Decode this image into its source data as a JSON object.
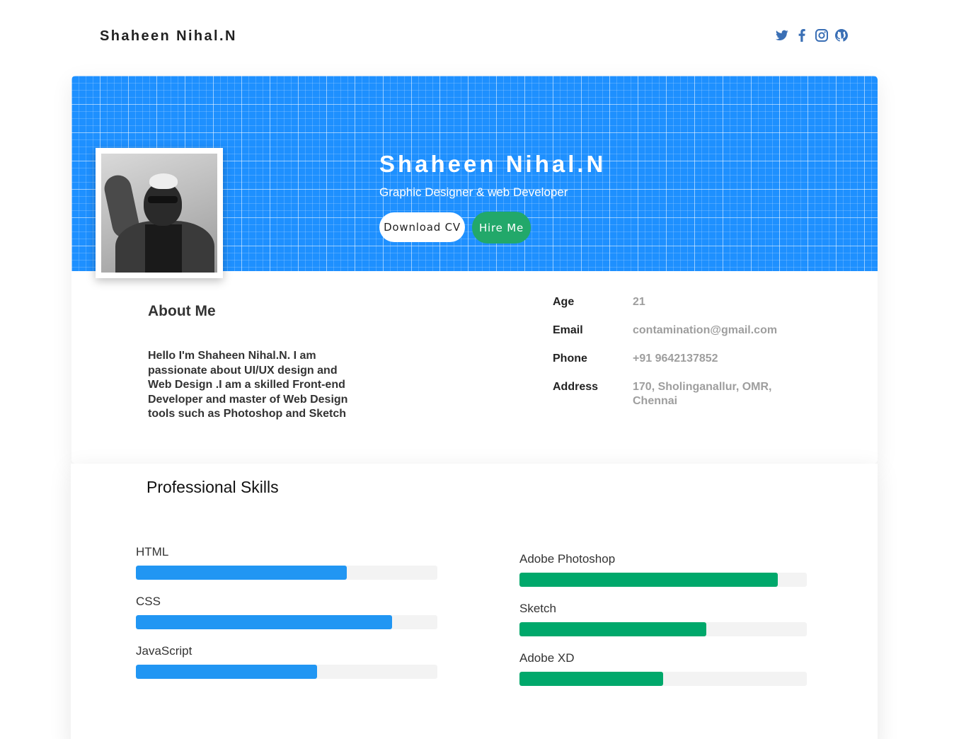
{
  "nav": {
    "brand": "Shaheen Nihal.N",
    "social": [
      "twitter-icon",
      "facebook-icon",
      "instagram-icon",
      "github-icon"
    ]
  },
  "colors": {
    "accent": "#1e90ff",
    "icon": "#3a6fb5",
    "green": "#00a86b",
    "blue_bar": "#2196f3"
  },
  "hero": {
    "name": "Shaheen Nihal.N",
    "role": "Graphic Designer & web Developer",
    "download_cv": "Download CV",
    "hire_me": "Hire Me"
  },
  "about": {
    "title": "About Me",
    "text": "Hello I'm Shaheen Nihal.N. I am passionate about UI/UX design and Web Design .I am a skilled Front-end Developer and master of Web Design tools such as Photoshop and Sketch"
  },
  "info": [
    {
      "label": "Age",
      "value": "21"
    },
    {
      "label": "Email",
      "value": "contamination@gmail.com"
    },
    {
      "label": "Phone",
      "value": "+91 9642137852"
    },
    {
      "label": "Address",
      "value": "170, Sholinganallur, OMR, Chennai"
    }
  ],
  "skills": {
    "title": "Professional Skills",
    "left": [
      {
        "name": "HTML",
        "percent": 70
      },
      {
        "name": "CSS",
        "percent": 85
      },
      {
        "name": "JavaScript",
        "percent": 60
      }
    ],
    "right": [
      {
        "name": "Adobe Photoshop",
        "percent": 90
      },
      {
        "name": "Sketch",
        "percent": 65
      },
      {
        "name": "Adobe XD",
        "percent": 50
      }
    ]
  }
}
